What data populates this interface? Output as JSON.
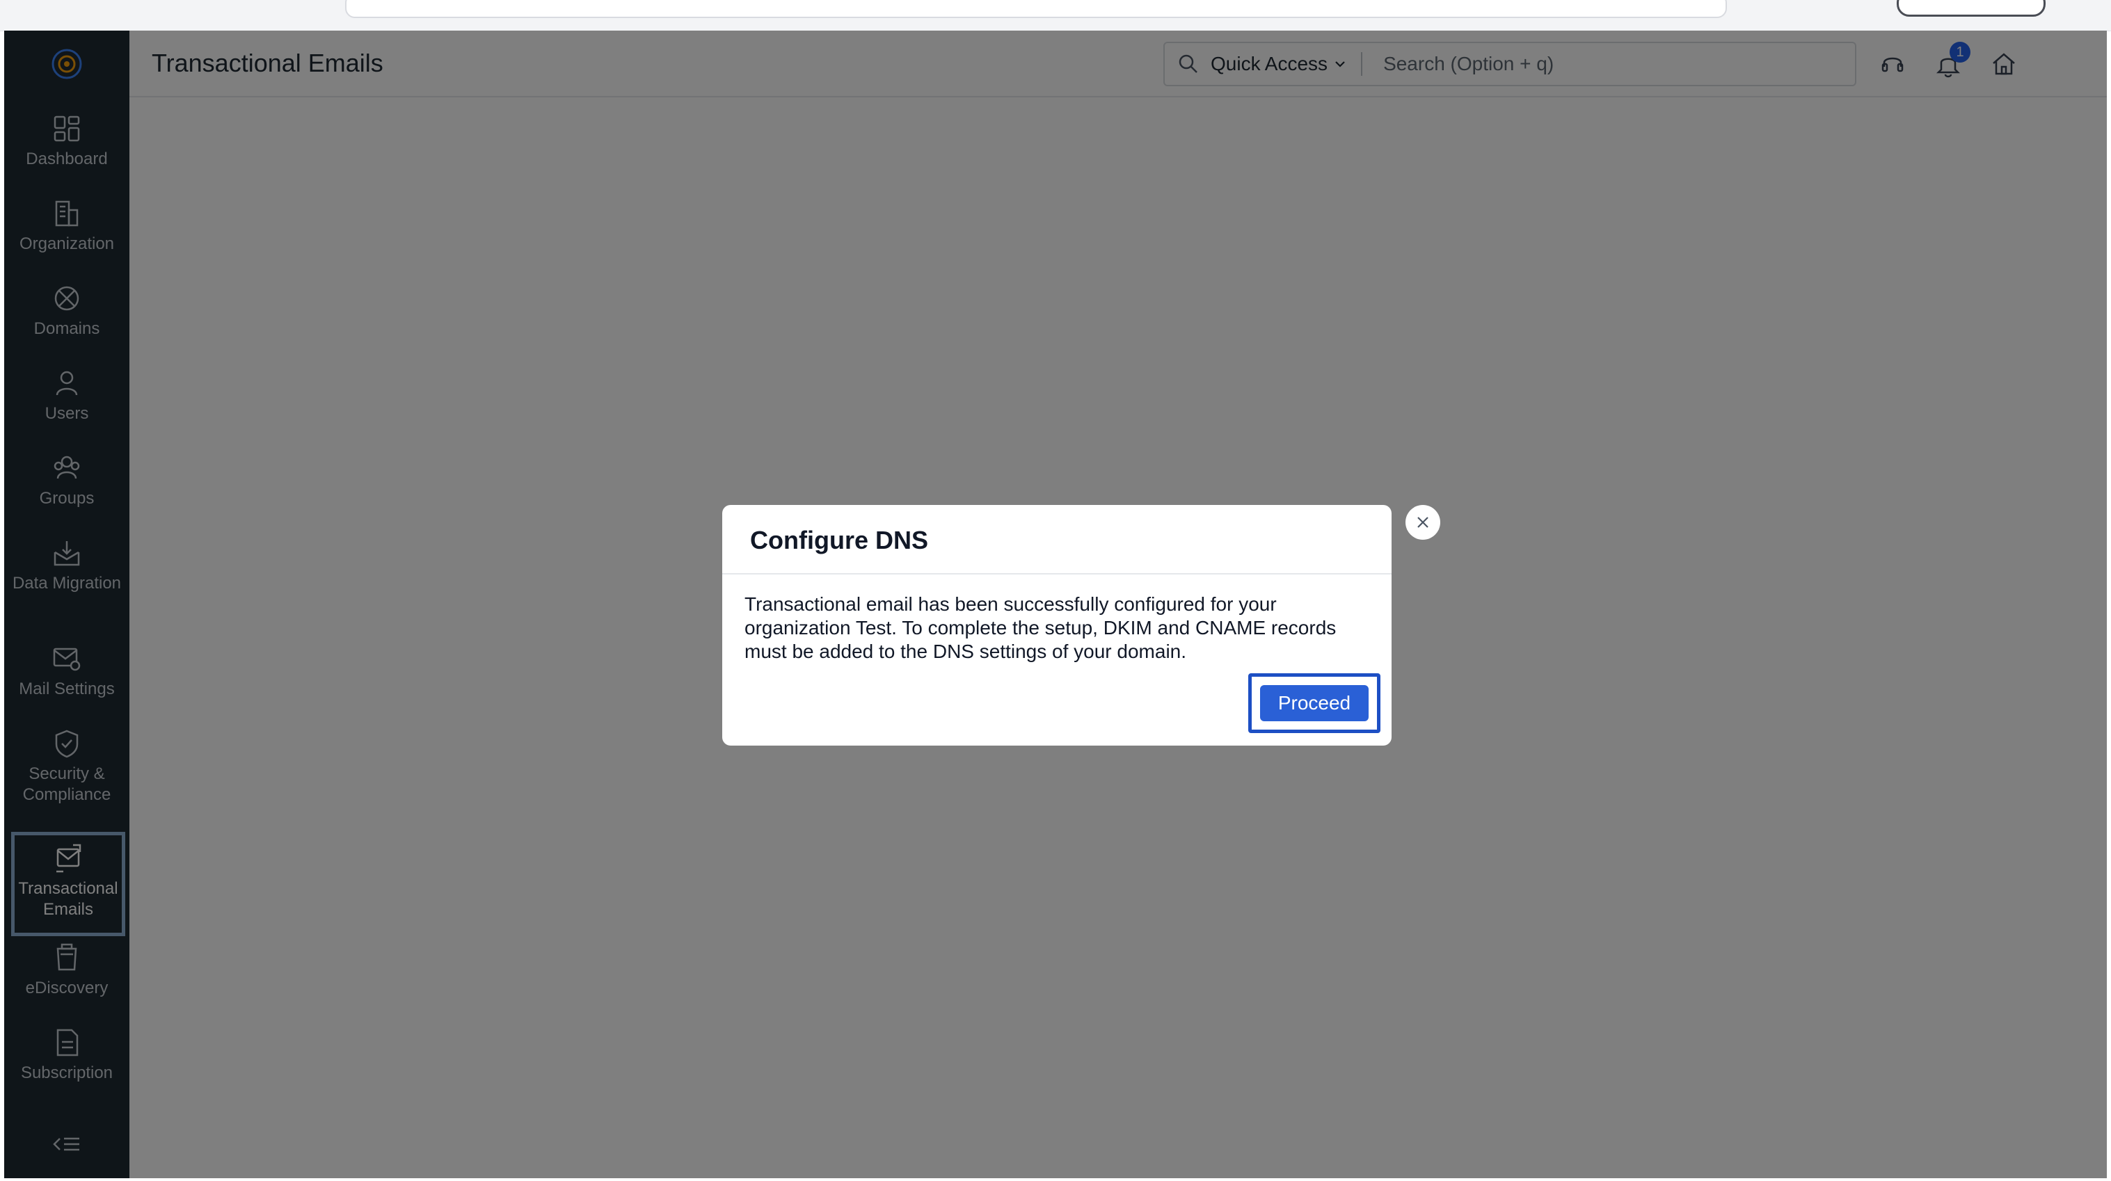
{
  "app": {
    "page_title": "Transactional Emails"
  },
  "sidebar": {
    "items": [
      {
        "label": "Dashboard",
        "icon": "dashboard-icon"
      },
      {
        "label": "Organization",
        "icon": "organization-icon"
      },
      {
        "label": "Domains",
        "icon": "domains-icon"
      },
      {
        "label": "Users",
        "icon": "users-icon"
      },
      {
        "label": "Groups",
        "icon": "groups-icon"
      },
      {
        "label": "Data Migration",
        "icon": "data-migration-icon"
      },
      {
        "label": "Mail Settings",
        "icon": "mail-settings-icon"
      },
      {
        "label": "Security & Compliance",
        "icon": "security-icon"
      },
      {
        "label": "Transactional Emails",
        "icon": "transactional-emails-icon",
        "active": true
      },
      {
        "label": "eDiscovery",
        "icon": "ediscovery-icon"
      },
      {
        "label": "Subscription",
        "icon": "subscription-icon"
      }
    ]
  },
  "header": {
    "quick_access_label": "Quick Access",
    "search_placeholder": "Search (Option + q)",
    "notification_count": "1"
  },
  "modal": {
    "title": "Configure DNS",
    "body": "Transactional email has been successfully configured for your organization Test. To complete the setup, DKIM and CNAME records must be added to the DNS settings of your domain.",
    "proceed_label": "Proceed"
  },
  "colors": {
    "sidebar_bg": "#1f2a33",
    "primary_button": "#2a60d6",
    "focus_outline": "#1d4fc4",
    "overlay": "rgba(0,0,0,0.5)"
  }
}
